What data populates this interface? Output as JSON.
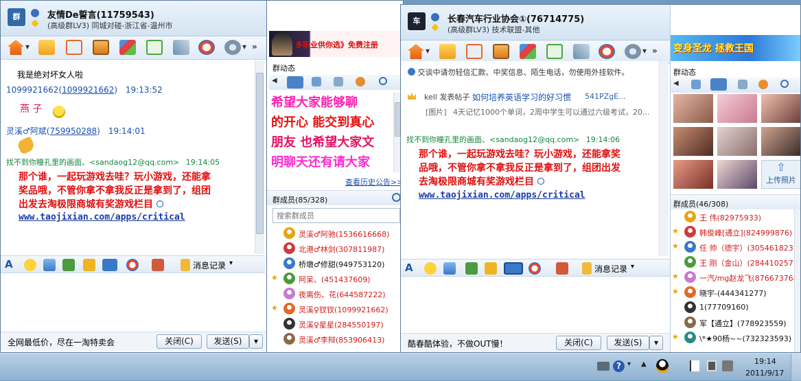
{
  "win1": {
    "title": "友情De誓言(11759543)",
    "subtitle": "(高级群LV3) 同城对碰-浙江省-温州市",
    "messages": [
      {
        "text": "我是绝对坏女人啦"
      },
      {
        "sender": "1099921662(",
        "sender_link": "1099921662",
        "sender_close": ")",
        "time": "19:13:52"
      },
      {
        "text": "燕 子"
      },
      {
        "sender": "灵溪♂阿斌(",
        "sender_link": "759950288",
        "sender_close": ")",
        "time": "19:14:01"
      }
    ],
    "sys_sender": "找不到你瞳孔里的画面、<sandaog12@qq.com>",
    "sys_time": "19:14:05",
    "red_lines": [
      "那个谁，一起玩游戏去哇？玩小游戏，还能拿",
      "奖品哦，不管你拿不拿我反正是拿到了，组团",
      "出发去淘极限商城有奖游戏栏目"
    ],
    "url": "www.taojixian.com/apps/critical",
    "msg_record": "消息记录",
    "ad_text": "全网最低价，尽在一淘特卖会",
    "close_btn": "关闭(C)",
    "send_btn": "发送(S)",
    "banner": "多职业供你选》免费注册",
    "group_dynamics": "群动态",
    "marquee": [
      "希望大家能够聊",
      "的开心 能交到真心",
      "朋友 也希望大家文",
      "明聊天还有请大家"
    ],
    "history_link": "查看历史公告>>",
    "members_title": "群成员(85/328)",
    "search_placeholder": "搜索群成员",
    "members": [
      {
        "name": "灵溪♂阿驰(1536616668)",
        "star": false,
        "color": "#d41a1a"
      },
      {
        "name": "北港♂林剑(307811987)",
        "star": false,
        "color": "#d41a1a"
      },
      {
        "name": "桥墩♂修甜(949753120)",
        "star": false,
        "color": "#111111"
      },
      {
        "name": "阿呆、(451437609)",
        "star": true,
        "color": "#d41a1a"
      },
      {
        "name": "夜离伤、花(644587222)",
        "star": false,
        "color": "#d41a1a"
      },
      {
        "name": "灵溪♀钗钗(1099921662)",
        "star": true,
        "color": "#d41a1a"
      },
      {
        "name": "灵溪♀星星(284550197)",
        "star": false,
        "color": "#d41a1a"
      },
      {
        "name": "灵溪♂李辩(853906413)",
        "star": false,
        "color": "#d41a1a"
      }
    ]
  },
  "win2": {
    "title": "长春汽车行业协会①(76714775)",
    "subtitle": "(高级群LV3) 技术联盟-其他",
    "notice": "交谈中请勿轻信汇款、中奖信息、陌生电话，勿使用外挂软件。",
    "post_user": "kell 发表帖子",
    "post_title": "如何培养英语学习的好习惯",
    "post_code": "541PZgE...",
    "post_pic": "[图片]",
    "post_desc": "4天记忆1000个单词，2周中学生可以通过六级考试，20...",
    "sys_sender": "找不到你瞳孔里的画面、<sandaog12@qq.com>",
    "sys_time": "19:14:06",
    "red_lines": [
      "那个谁，一起玩游戏去哇？玩小游戏，还能拿奖",
      "品哦，不管你拿不拿我反正是拿到了，组团出发",
      "去淘极限商城有奖游戏栏目"
    ],
    "url": "www.taojixian.com/apps/critical",
    "msg_record": "消息记录",
    "ad_text": "酷春酷体验，不做OUT慢！",
    "close_btn": "关闭(C)",
    "send_btn": "发送(S)",
    "banner": "变身圣龙 拯救王国",
    "group_dynamics": "群动态",
    "upload_label": "上传照片",
    "members_title": "群成员(46/308)",
    "members": [
      {
        "name": "王 伟(82975933)",
        "star": false,
        "color": "#d41a1a"
      },
      {
        "name": "韩俊峰[通立](824999876)",
        "star": true,
        "color": "#d41a1a"
      },
      {
        "name": "任 帅（德宇）(305461823)",
        "star": true,
        "color": "#d41a1a"
      },
      {
        "name": "王 刚（金山）(284410257)",
        "star": false,
        "color": "#d41a1a"
      },
      {
        "name": "一汽/mg赵龙飞(876673768)",
        "star": true,
        "color": "#d41a1a"
      },
      {
        "name": "晓宇-(444341277)",
        "star": true,
        "color": "#111111"
      },
      {
        "name": "1(77709160)",
        "star": false,
        "color": "#111111"
      },
      {
        "name": "军【通立】(778923559)",
        "star": false,
        "color": "#111111"
      },
      {
        "name": "\\*★90杨~~(732323593)",
        "star": true,
        "color": "#111111"
      }
    ]
  },
  "taskbar": {
    "time": "19:14",
    "date": "2011/9/17"
  }
}
